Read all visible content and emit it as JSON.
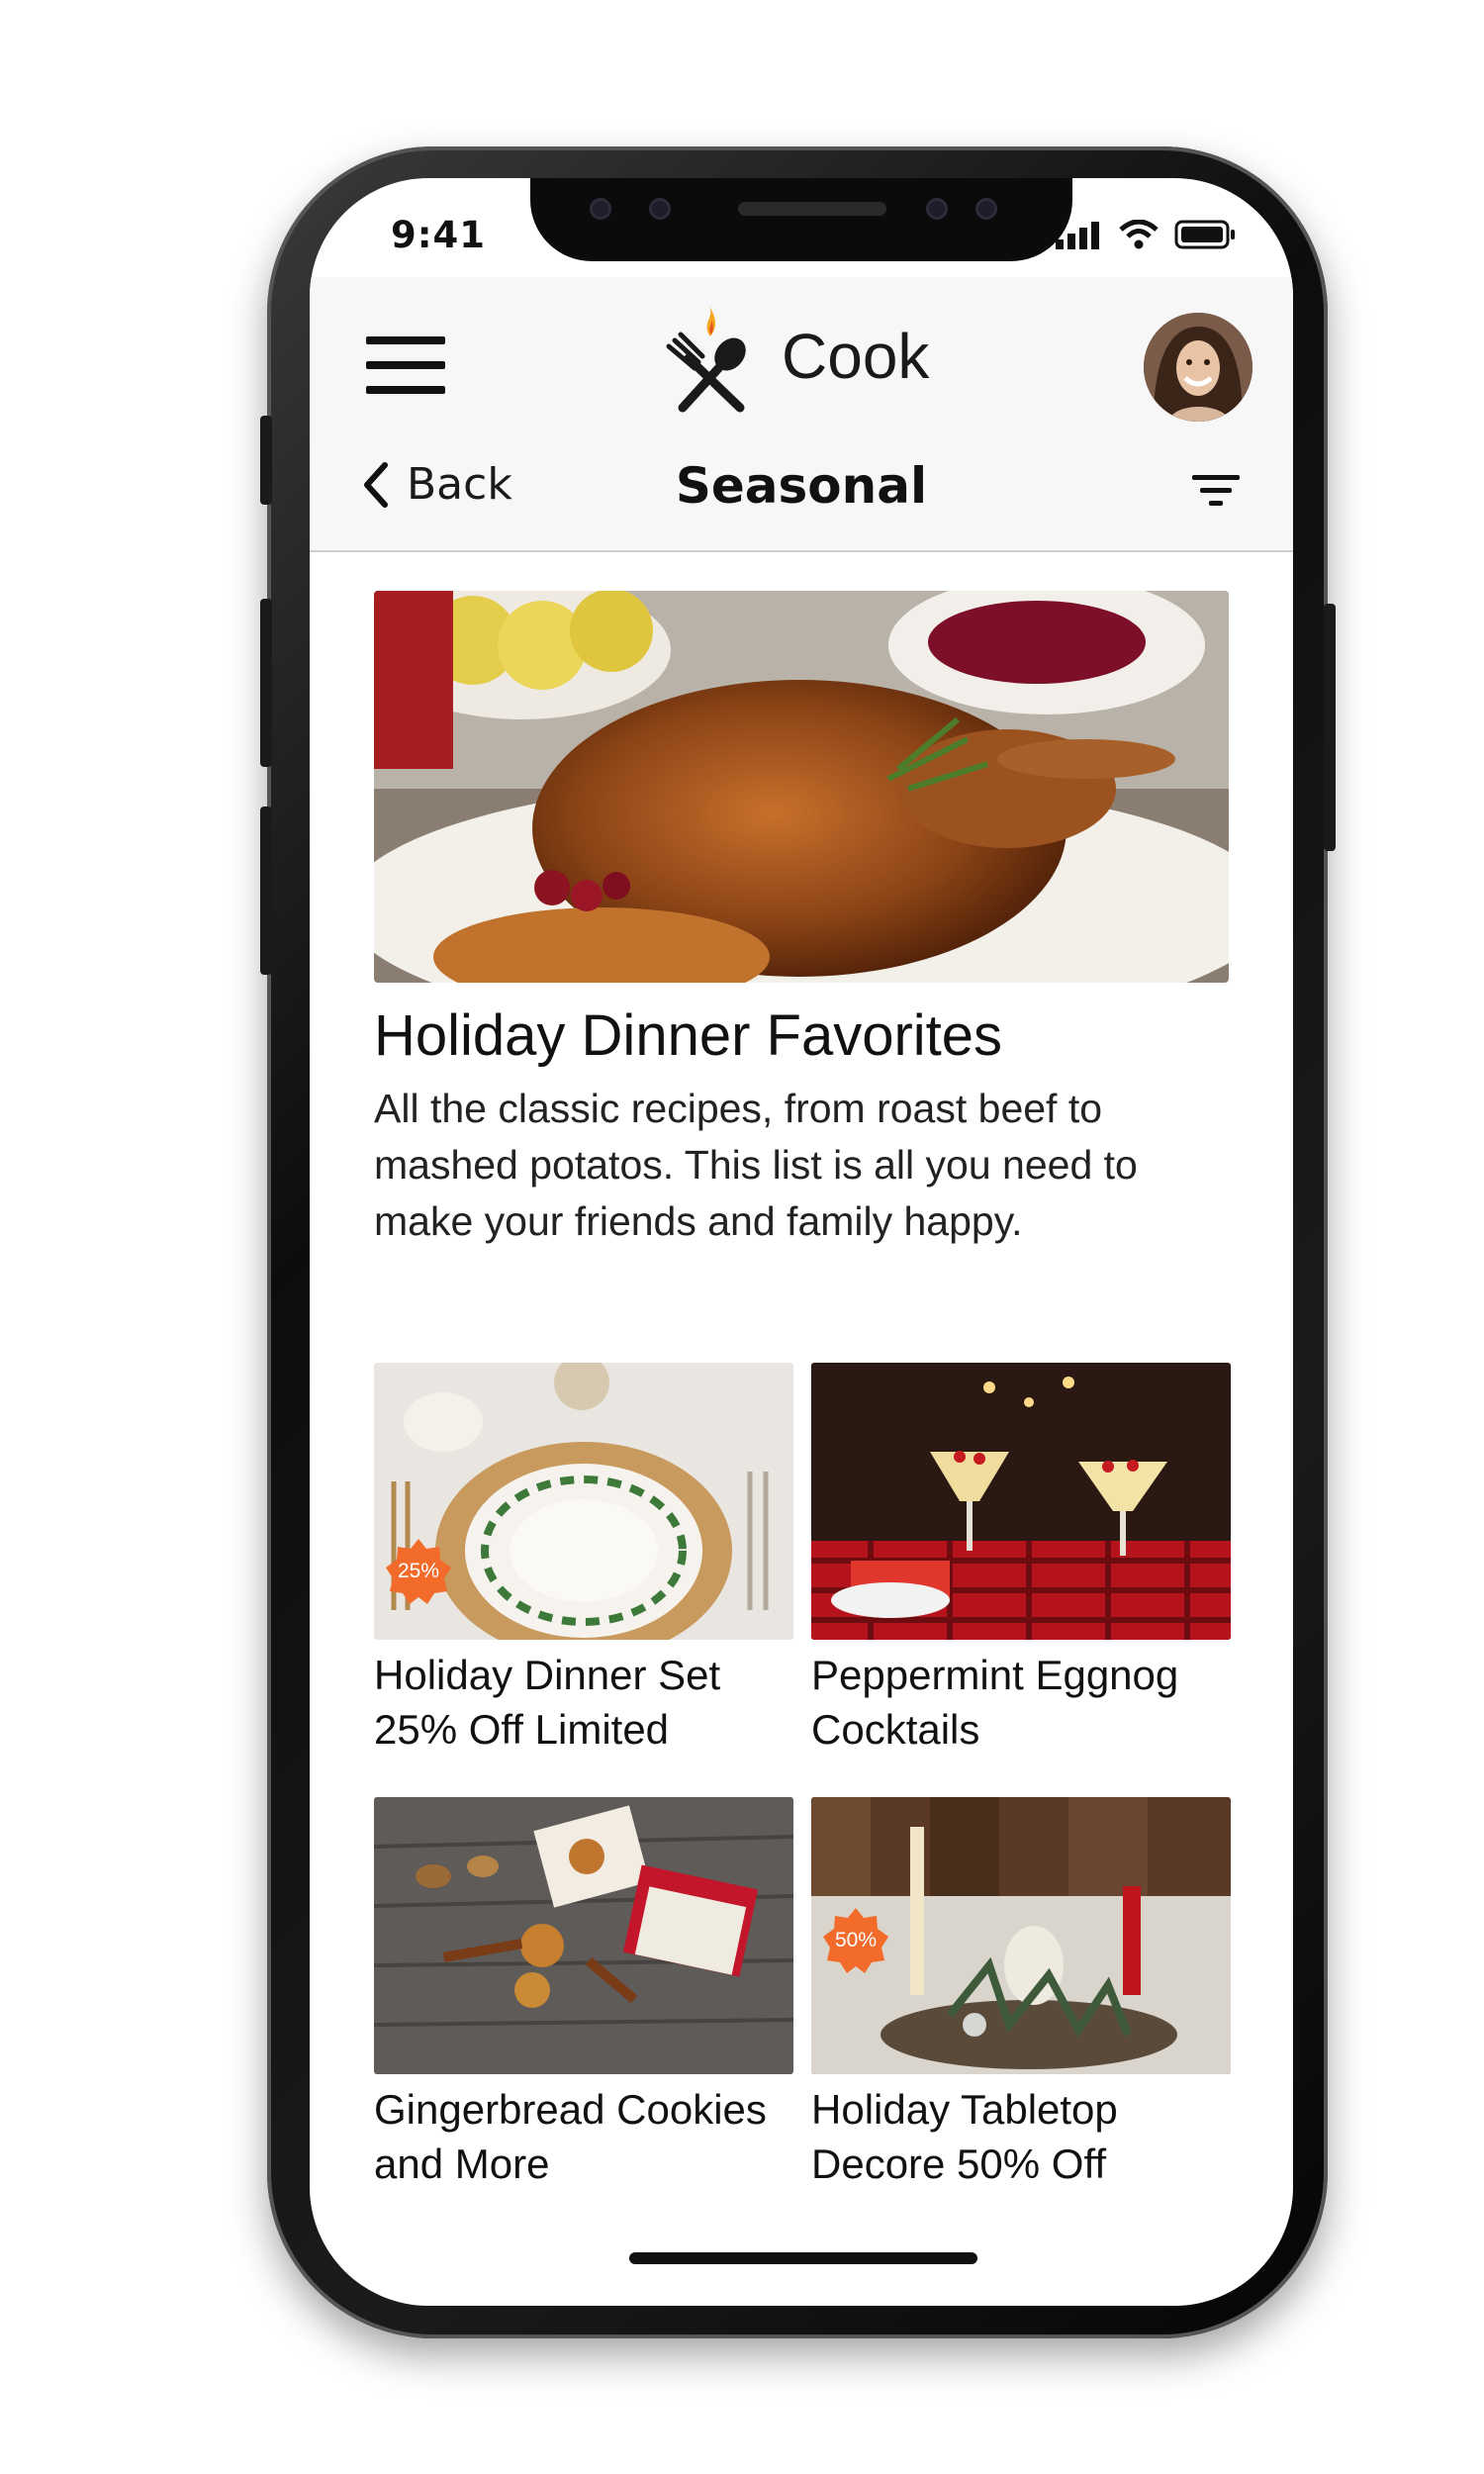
{
  "status_bar": {
    "time": "9:41"
  },
  "header": {
    "brand": "Cook"
  },
  "nav": {
    "back_label": "Back",
    "title": "Seasonal"
  },
  "hero": {
    "title": "Holiday Dinner Favorites",
    "description": "All the classic recipes, from roast beef to mashed potatos. This list is all you need to make your friends and family happy."
  },
  "cards": [
    {
      "title": "Holiday Dinner Set 25% Off Limited",
      "badge": "25%"
    },
    {
      "title": "Peppermint Eggnog Cocktails"
    },
    {
      "title": "Gingerbread Cookies and More"
    },
    {
      "title": "Holiday Tabletop Decore 50% Off",
      "badge": "50%"
    }
  ],
  "colors": {
    "accent": "#f26b2a",
    "flame": "#f5a623",
    "divider": "#cfcfcf"
  }
}
